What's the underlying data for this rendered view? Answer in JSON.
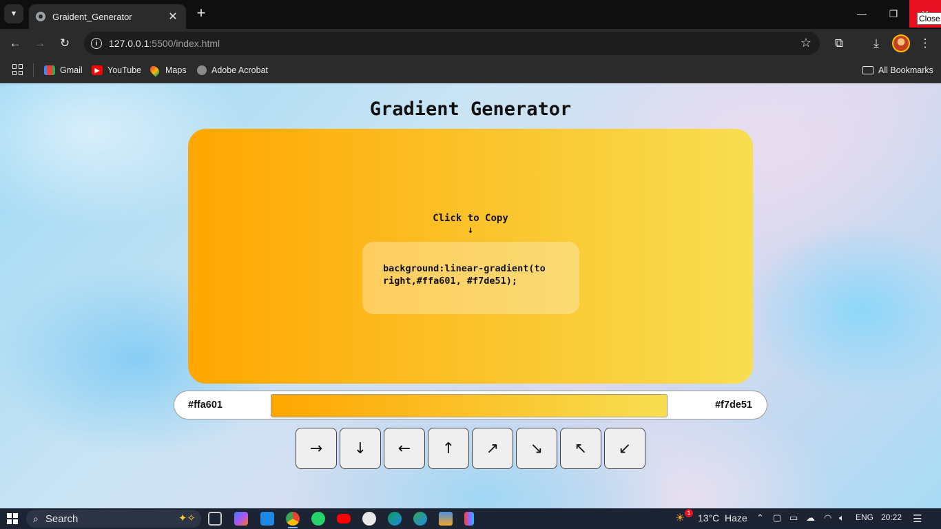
{
  "browser": {
    "tab": {
      "title": "Graident_Generator",
      "close": "✕"
    },
    "window_tooltip": "Close",
    "url_host": "127.0.0.1",
    "url_path": ":5500/index.html",
    "bookmarks": [
      {
        "label": "Gmail",
        "icon": "gmail-icon"
      },
      {
        "label": "YouTube",
        "icon": "youtube-icon"
      },
      {
        "label": "Maps",
        "icon": "maps-icon"
      },
      {
        "label": "Adobe Acrobat",
        "icon": "acrobat-icon"
      }
    ],
    "all_bookmarks": "All Bookmarks"
  },
  "page": {
    "title": "Gradient Generator",
    "copy_hint": "Click to Copy",
    "copy_arrow": "↓",
    "code_text": "background:linear-gradient(to right,#ffa601, #f7de51);",
    "color_left": "#ffa601",
    "color_right": "#f7de51",
    "gradient_direction": "to right",
    "directions": [
      "→",
      "↓",
      "←",
      "↑",
      "↗",
      "↘",
      "↖",
      "↙"
    ]
  },
  "taskbar": {
    "search_placeholder": "Search",
    "weather": "13°C  Haze",
    "language": "ENG",
    "time": "20:22",
    "notification_count": "1"
  },
  "colors": {
    "gradient_start": "#ffa601",
    "gradient_end": "#f7de51",
    "chrome_bg": "#2b2b2b",
    "close_red": "#e81123"
  }
}
